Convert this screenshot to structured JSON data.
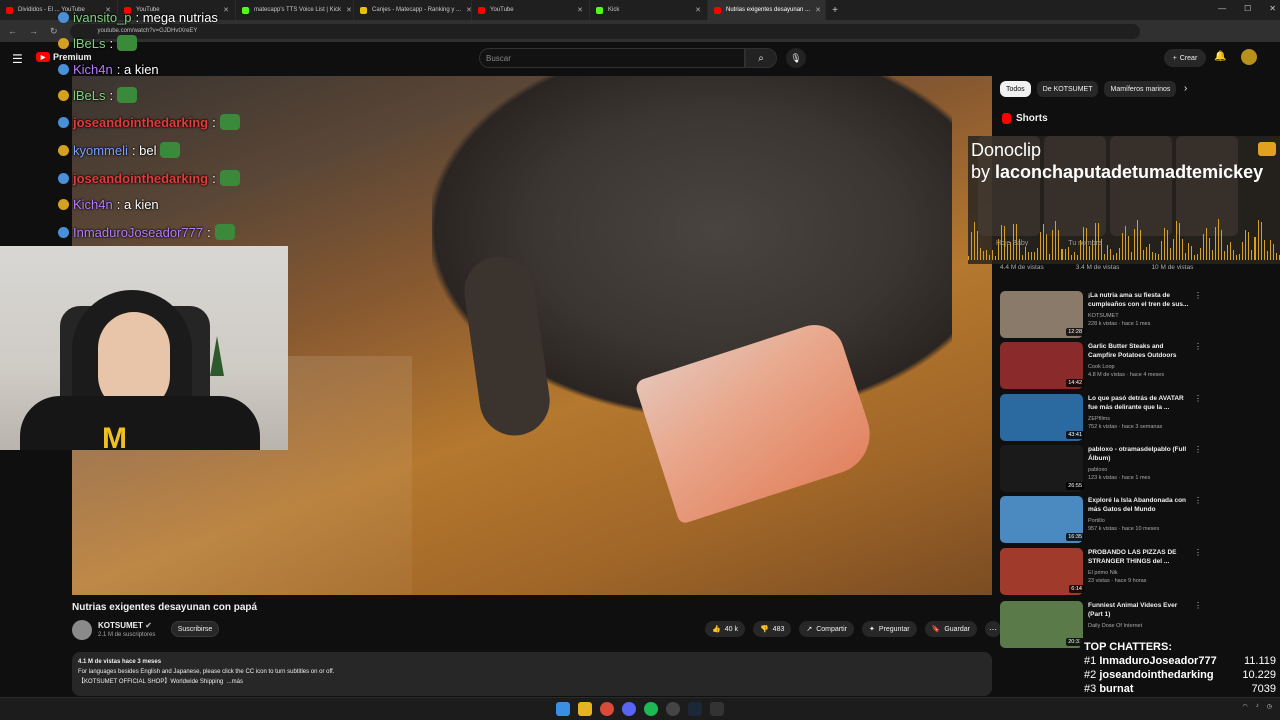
{
  "browser": {
    "tabs": [
      {
        "title": "Divididos - El ... YouTube",
        "color": "#ff0000",
        "active": false
      },
      {
        "title": "YouTube",
        "color": "#ff0000",
        "active": false
      },
      {
        "title": "matecapp's TTS Voice List | Kick",
        "color": "#53fc18",
        "active": false
      },
      {
        "title": "Canjes - Matecapp - Ranking y ...",
        "color": "#e6c300",
        "active": false
      },
      {
        "title": "YouTube",
        "color": "#ff0000",
        "active": false
      },
      {
        "title": "Kick",
        "color": "#53fc18",
        "active": false
      },
      {
        "title": "Nutrias exigentes desayunan ...",
        "color": "#ff0000",
        "active": true
      }
    ],
    "url": "youtube.com/watch?v=GJDHvtXreEY"
  },
  "youtube": {
    "logo_label": "Premium",
    "search_placeholder": "Buscar",
    "create_label": "Crear"
  },
  "chat": [
    {
      "user": "ivansito_p",
      "msg": ": mega nutrias",
      "cls": "u-green"
    },
    {
      "user": "lBeLs",
      "msg": ":",
      "cls": "u-green"
    },
    {
      "user": "Kich4n",
      "msg": ": a kien",
      "cls": "u-purple"
    },
    {
      "user": "lBeLs",
      "msg": ":",
      "cls": "u-green"
    },
    {
      "user": "joseandointhedarking",
      "msg": ":",
      "cls": "u-red"
    },
    {
      "user": "kyommeli",
      "msg": ": bel",
      "cls": "u-blue"
    },
    {
      "user": "joseandointhedarking",
      "msg": ":",
      "cls": "u-red"
    },
    {
      "user": "Kich4n",
      "msg": ": a kien",
      "cls": "u-purple"
    },
    {
      "user": "InmaduroJoseador777",
      "msg": ":",
      "cls": "u-purple"
    }
  ],
  "video": {
    "title": "Nutrias exigentes desayunan con papá",
    "channel": "KOTSUMET",
    "subs": "2.1 M de suscriptores",
    "subscribe_label": "Suscribirse",
    "likes": "40 k",
    "dislikes": "483",
    "share_label": "Compartir",
    "ask_label": "Preguntar",
    "save_label": "Guardar",
    "meta": "4.1 M de vistas  hace 3 meses",
    "desc_line1": "For languages besides English and Japanese, please click the CC icon to turn subtitles on or off.",
    "desc_line2": "【KOTSUMET OFFICIAL SHOP】Worldwide Shipping",
    "more_label": "...más"
  },
  "sidebar": {
    "chips": [
      "Todos",
      "De KOTSUMET",
      "Mamíferos marinos"
    ],
    "shorts_label": "Shorts",
    "shorts_views": [
      "4.4 M de vistas",
      "3.4 M de vistas",
      "10 M de vistas"
    ],
    "recommendations": [
      {
        "title": "¡La nutria ama su fiesta de cumpleaños con el tren de sus...",
        "channel": "KOTSUMET",
        "views": "228 k vistas · hace 1 mes",
        "duration": "12:28",
        "color": "#8a7a6a"
      },
      {
        "title": "Garlic Butter Steaks and Campfire Potatoes Outdoors",
        "channel": "Cook Loop",
        "views": "4.8 M de vistas · hace 4 meses",
        "duration": "14:42",
        "color": "#8a2a2a"
      },
      {
        "title": "Lo que pasó detrás de AVATAR fue más delirante que la ...",
        "channel": "ZEPfilms",
        "views": "752 k vistas · hace 3 semanas",
        "duration": "43:41",
        "color": "#2a6aa0"
      },
      {
        "title": "pabloxo - otramasdelpablo (Full Álbum)",
        "channel": "pabloxo",
        "views": "123 k vistas · hace 1 mes",
        "duration": "26:55",
        "color": "#1a1a1a"
      },
      {
        "title": "Exploré la Isla Abandonada con más Gatos del Mundo",
        "channel": "Portillo",
        "views": "957 k vistas · hace 10 meses",
        "duration": "16:35",
        "color": "#4a8ac0"
      },
      {
        "title": "PROBANDO LAS PIZZAS DE STRANGER THINGS del ...",
        "channel": "El primo Nik",
        "views": "23 vistas · hace 9 horas",
        "duration": "6:14",
        "color": "#a03a2a"
      },
      {
        "title": "Funniest Animal Videos Ever (Part 1)",
        "channel": "Daily Dose Of Internet",
        "views": "",
        "duration": "20:31",
        "color": "#5a7a4a"
      }
    ]
  },
  "overlay": {
    "title": "Donoclip",
    "by": "by",
    "author": "laconchaputadetumadtemickey",
    "captions": [
      "Hoje Baby",
      "Tu nombre"
    ]
  },
  "top_chatters": {
    "title": "TOP CHATTERS:",
    "rows": [
      {
        "rank": "#1",
        "name": "InmaduroJoseador777",
        "count": "11.119"
      },
      {
        "rank": "#2",
        "name": "joseandointhedarking",
        "count": "10.229"
      },
      {
        "rank": "#3",
        "name": "burnat",
        "count": "7039"
      }
    ]
  }
}
